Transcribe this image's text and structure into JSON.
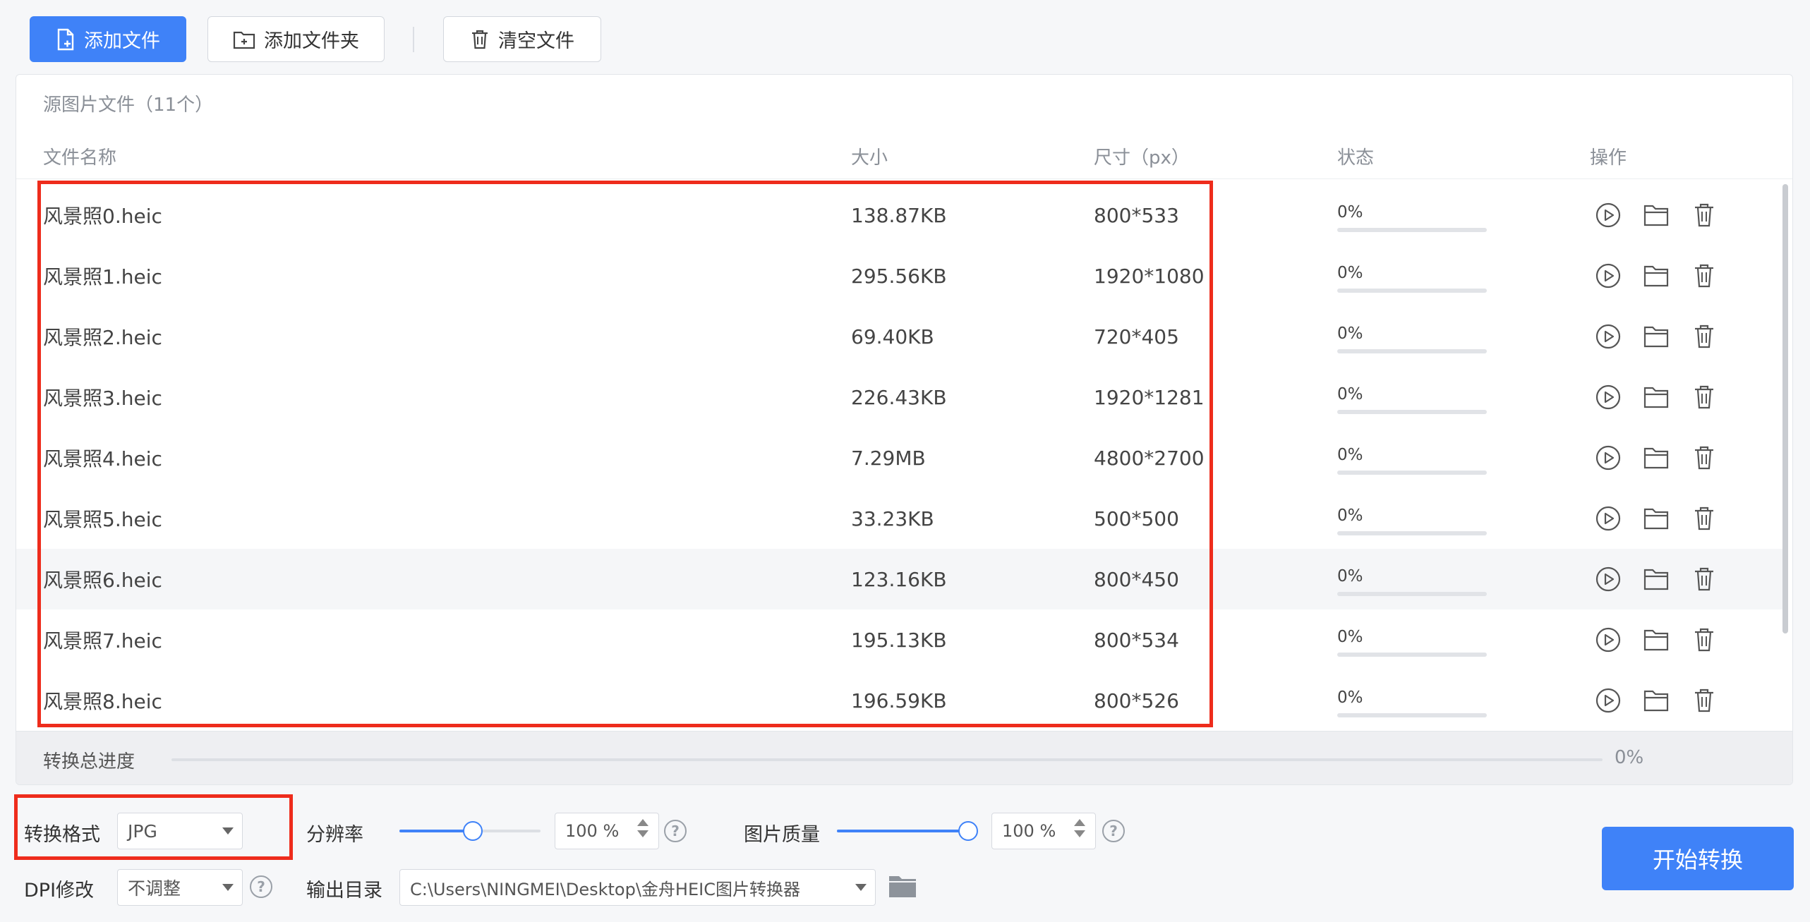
{
  "toolbar": {
    "add_file": "添加文件",
    "add_folder": "添加文件夹",
    "clear_files": "清空文件"
  },
  "file_list": {
    "title": "源图片文件（11个）",
    "columns": {
      "name": "文件名称",
      "size": "大小",
      "dimensions": "尺寸（px）",
      "status": "状态",
      "actions": "操作"
    },
    "rows": [
      {
        "name": "风景照0.heic",
        "size": "138.87KB",
        "dimensions": "800*533",
        "status": "0%",
        "progress": 0
      },
      {
        "name": "风景照1.heic",
        "size": "295.56KB",
        "dimensions": "1920*1080",
        "status": "0%",
        "progress": 0
      },
      {
        "name": "风景照2.heic",
        "size": "69.40KB",
        "dimensions": "720*405",
        "status": "0%",
        "progress": 0
      },
      {
        "name": "风景照3.heic",
        "size": "226.43KB",
        "dimensions": "1920*1281",
        "status": "0%",
        "progress": 0
      },
      {
        "name": "风景照4.heic",
        "size": "7.29MB",
        "dimensions": "4800*2700",
        "status": "0%",
        "progress": 0
      },
      {
        "name": "风景照5.heic",
        "size": "33.23KB",
        "dimensions": "500*500",
        "status": "0%",
        "progress": 0
      },
      {
        "name": "风景照6.heic",
        "size": "123.16KB",
        "dimensions": "800*450",
        "status": "0%",
        "progress": 0
      },
      {
        "name": "风景照7.heic",
        "size": "195.13KB",
        "dimensions": "800*534",
        "status": "0%",
        "progress": 0
      },
      {
        "name": "风景照8.heic",
        "size": "196.59KB",
        "dimensions": "800*526",
        "status": "0%",
        "progress": 0
      }
    ],
    "highlighted_row": 6,
    "row_action_icons": [
      "play-icon",
      "folder-icon",
      "trash-icon"
    ]
  },
  "total_progress": {
    "label": "转换总进度",
    "value": "0%",
    "progress": 0
  },
  "settings": {
    "format_label": "转换格式",
    "format_value": "JPG",
    "resolution_label": "分辨率",
    "resolution_value": "100",
    "resolution_unit": "%",
    "resolution_level": 1.0,
    "quality_label": "图片质量",
    "quality_value": "100",
    "quality_unit": "%",
    "quality_level": 1.0,
    "dpi_label": "DPI修改",
    "dpi_value": "不调整",
    "output_label": "输出目录",
    "output_value": "C:\\Users\\NINGMEI\\Desktop\\金舟HEIC图片转换器",
    "help_symbol": "?"
  },
  "start_button": "开始转换",
  "colors": {
    "accent": "#3f82f8",
    "highlight_box": "#ee2c1c"
  }
}
